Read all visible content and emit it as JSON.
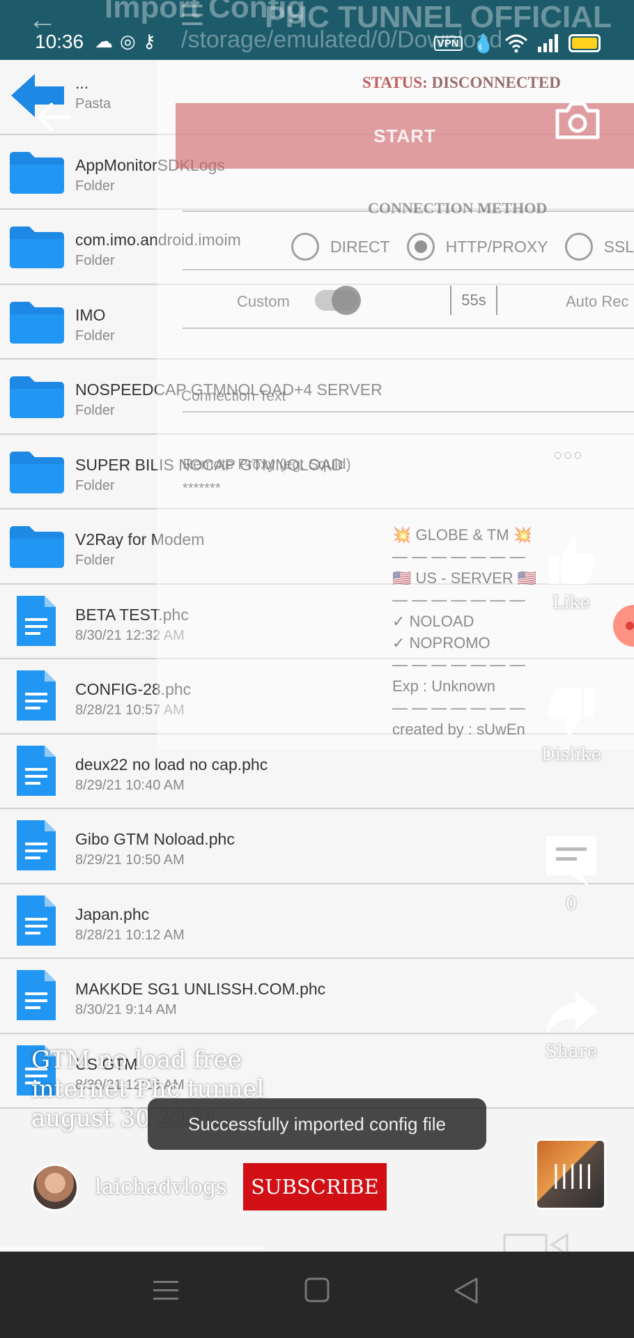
{
  "status_bar": {
    "time": "10:36",
    "left_icons": [
      "cloud-icon",
      "chrome-icon",
      "key-icon"
    ],
    "vpn_label": "VPN",
    "right_icons": [
      "vpn-icon",
      "drop-icon",
      "wifi-icon",
      "signal-icon",
      "battery-icon"
    ]
  },
  "background_header": {
    "title": "Import Config",
    "path": "/storage/emulated/0/Download",
    "app_title": "PHC TUNNEL OFFICIAL"
  },
  "file_list": [
    {
      "name": "...",
      "sub": "Pasta",
      "type": "up"
    },
    {
      "name": "AppMonitorSDKLogs",
      "sub": "Folder",
      "type": "folder"
    },
    {
      "name": "com.imo.android.imoim",
      "sub": "Folder",
      "type": "folder"
    },
    {
      "name": "IMO",
      "sub": "Folder",
      "type": "folder"
    },
    {
      "name": "NOSPEEDCAP GTMNOLOAD+4 SERVER",
      "sub": "Folder",
      "type": "folder"
    },
    {
      "name": "SUPER BILIS NOCAP GTMNOLOAD",
      "sub": "Folder",
      "type": "folder"
    },
    {
      "name": "V2Ray for Modem",
      "sub": "Folder",
      "type": "folder"
    },
    {
      "name": "BETA TEST.phc",
      "sub": "8/30/21 12:32 AM",
      "type": "file"
    },
    {
      "name": "CONFIG-28.phc",
      "sub": "8/28/21 10:57 AM",
      "type": "file"
    },
    {
      "name": "deux22 no load no cap.phc",
      "sub": "8/29/21 10:40 AM",
      "type": "file"
    },
    {
      "name": "Gibo GTM Noload.phc",
      "sub": "8/29/21 10:50 AM",
      "type": "file"
    },
    {
      "name": "Japan.phc",
      "sub": "8/28/21 10:12 AM",
      "type": "file"
    },
    {
      "name": "MAKKDE SG1 UNLISSH.COM.phc",
      "sub": "8/30/21 9:14 AM",
      "type": "file"
    },
    {
      "name": "US GTM",
      "sub": "8/30/21 12:16 AM",
      "type": "file"
    }
  ],
  "overlay_app": {
    "status_label": "STATUS:",
    "status_value": "DISCONNECTED",
    "start_label": "START",
    "connection_method": "CONNECTION METHOD",
    "options": [
      {
        "label": "DIRECT",
        "selected": false
      },
      {
        "label": "HTTP/PROXY",
        "selected": true
      },
      {
        "label": "SSL/T",
        "selected": false
      }
    ],
    "custom_label": "Custom",
    "custom_enabled": true,
    "timer": "55s",
    "auto_reconnect": "Auto Rec",
    "connection_text_placeholder": "Connection Text",
    "remote_proxy_placeholder": "Remote Proxy (eg: Squid)",
    "remote_proxy_value": "*******",
    "more_label": "○○○",
    "config_note": [
      "💥 GLOBE & TM 💥",
      "— — — — — — —",
      "🇺🇸 US - SERVER 🇺🇸",
      "— — — — — — —",
      "✓ NOLOAD",
      "✓ NOPROMO",
      "— — — — — — —",
      "Exp : Unknown",
      "— — — — — — —",
      "created by : sUwEn"
    ]
  },
  "side_actions": {
    "like_label": "Like",
    "dislike_label": "Dislike",
    "comments_count": "0",
    "share_label": "Share"
  },
  "video": {
    "caption_lines": [
      "GTM no load free",
      "internet Phc tunnel",
      "august 30 2021"
    ],
    "toast": "Successfully imported config file",
    "channel_name": "laichadvlogs",
    "subscribe_label": "SUBSCRIBE",
    "progress_fraction": 0.415
  },
  "colors": {
    "header_bg": "#1d5b6a",
    "folder_blue": "#1e88e5",
    "file_blue": "#2196f3",
    "subscribe_red": "#d10f14",
    "nav_bg": "#272727",
    "start_btn": "#cd5f64"
  }
}
